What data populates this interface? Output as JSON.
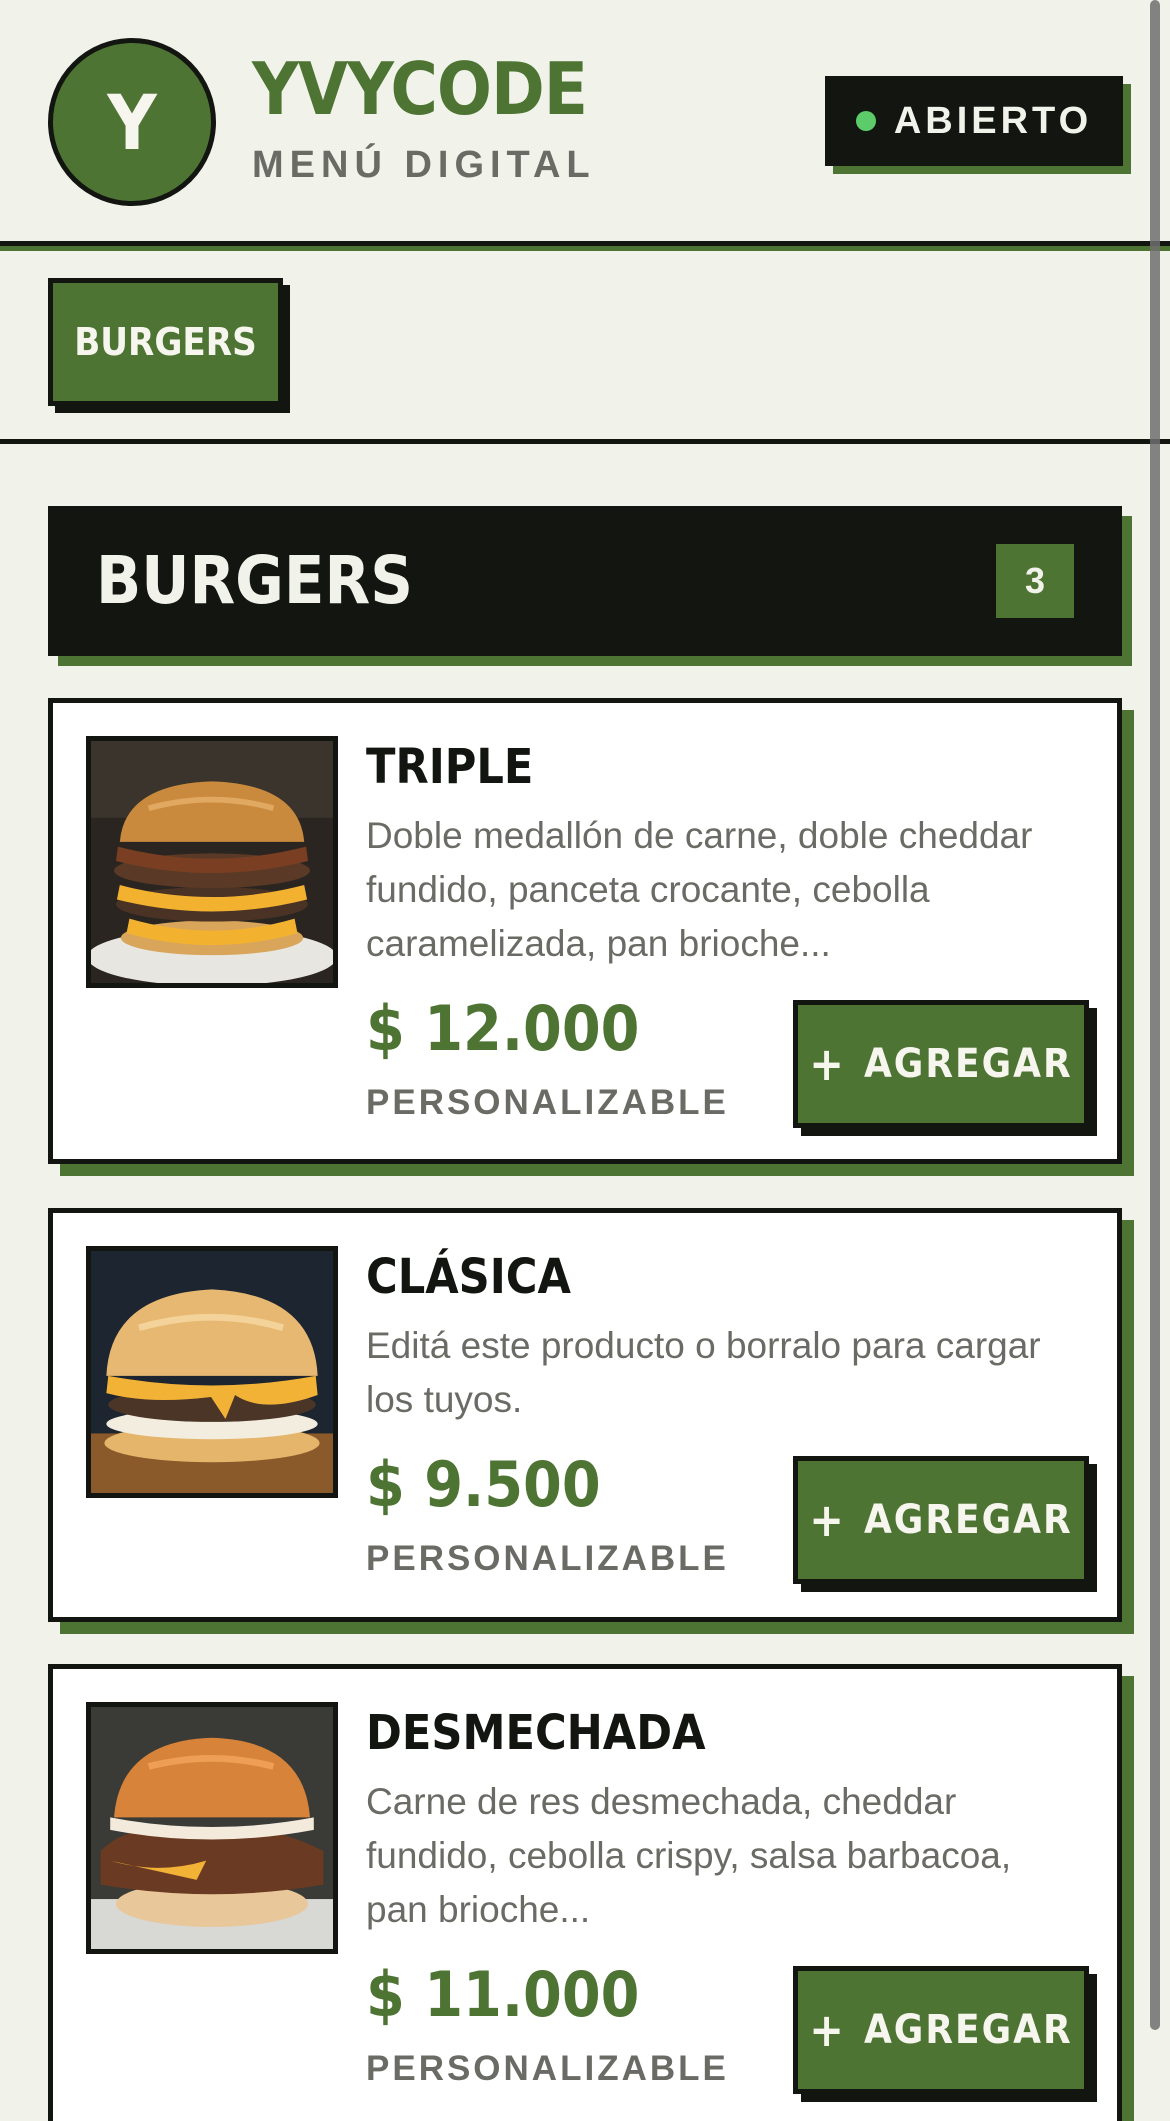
{
  "header": {
    "logo_letter": "Y",
    "title": "YVYCODE",
    "subtitle": "MENÚ DIGITAL",
    "status": "ABIERTO",
    "status_color": "#5ccc6a"
  },
  "category_nav": {
    "items": [
      {
        "label": "BURGERS",
        "active": true
      }
    ]
  },
  "section": {
    "title": "BURGERS",
    "count": "3"
  },
  "products": [
    {
      "name": "TRIPLE",
      "description": "Doble medallón de carne, doble cheddar fundido, panceta crocante, cebolla caramelizada, pan brioche...",
      "price": "$ 12.000",
      "tag": "PERSONALIZABLE",
      "button_label": "AGREGAR",
      "image": "burger-photo"
    },
    {
      "name": "CLÁSICA",
      "description": "Editá este producto o borralo para cargar los tuyos.",
      "price": "$ 9.500",
      "tag": "PERSONALIZABLE",
      "button_label": "AGREGAR",
      "image": "burger-photo"
    },
    {
      "name": "DESMECHADA",
      "description": "Carne de res desmechada, cheddar fundido, cebolla crispy, salsa barbacoa, pan brioche...",
      "price": "$ 11.000",
      "tag": "PERSONALIZABLE",
      "button_label": "AGREGAR",
      "image": "burger-photo"
    }
  ],
  "colors": {
    "background": "#f1f2ea",
    "accent_green": "#4e7434",
    "ink": "#121510",
    "muted_text": "#6b6b66"
  }
}
